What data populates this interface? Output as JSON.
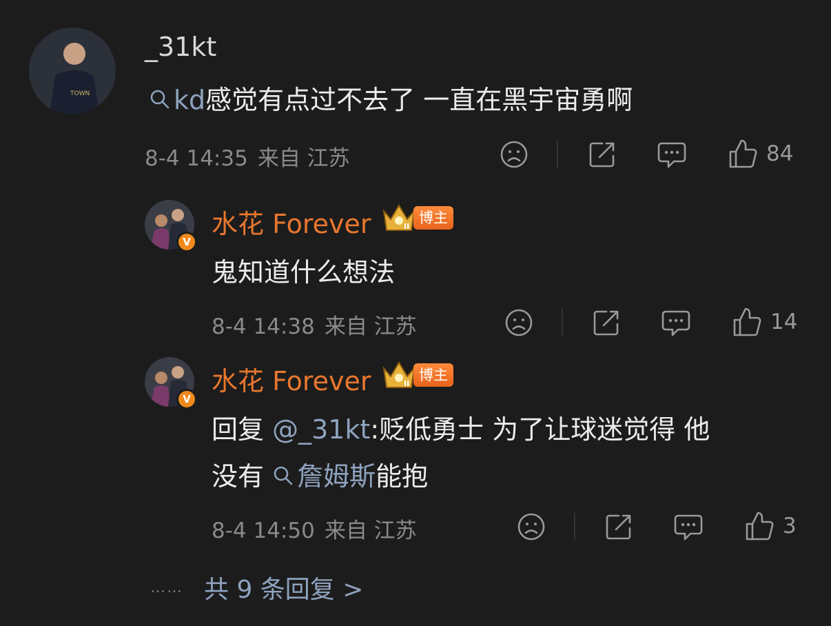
{
  "comment": {
    "username": "_31kt",
    "search_keyword": "kd",
    "text": "感觉有点过不去了 一直在黑宇宙勇啊",
    "time": "8-4 14:35",
    "location": "来自 江苏",
    "likes": "84"
  },
  "replies": [
    {
      "username": "水花 Forever",
      "badge_label": "博主",
      "verified_glyph": "V",
      "text": "鬼知道什么想法",
      "time": "8-4 14:38",
      "location": "来自 江苏",
      "likes": "14"
    },
    {
      "username": "水花 Forever",
      "badge_label": "博主",
      "verified_glyph": "V",
      "reply_prefix": "回复 ",
      "mention": "@_31kt",
      "text_part1": ":贬低勇士 为了让球迷觉得 他",
      "text_part2_prefix": "没有 ",
      "search_keyword": "詹姆斯",
      "text_part2_suffix": "能抱",
      "time": "8-4 14:50",
      "location": "来自 江苏",
      "likes": "3"
    }
  ],
  "more": {
    "dots": "……",
    "label": "共 9 条回复 >"
  },
  "colors": {
    "background": "#1c1c1c",
    "accent_orange": "#e8772e",
    "link_blue": "#8fa3bf",
    "meta_gray": "#8a8a8a"
  },
  "icons": [
    "search-icon",
    "sad-face-icon",
    "share-icon",
    "comment-icon",
    "thumbs-up-icon",
    "crown-icon",
    "verified-icon"
  ]
}
